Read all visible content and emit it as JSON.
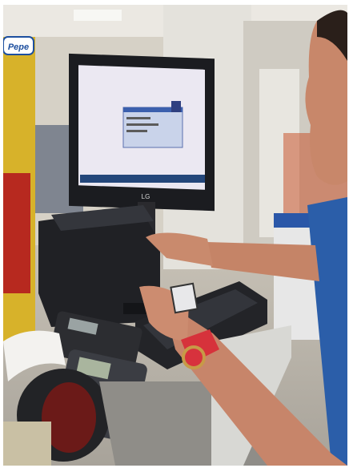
{
  "photo": {
    "scene": "checkout-counter",
    "brand_sign_text": "Pepe",
    "monitor_brand": "LG",
    "colors": {
      "wall": "#d8d2c6",
      "ceiling": "#e9e6df",
      "monitor_frame": "#1b1c20",
      "screen": "#e9e6f1",
      "printer": "#1e1f23",
      "counter": "#8d8b86",
      "shelf_blue": "#2a57a8",
      "watch_red": "#d6323b",
      "skin": "#c8876a",
      "shirt_blue": "#2b5ea9"
    }
  }
}
